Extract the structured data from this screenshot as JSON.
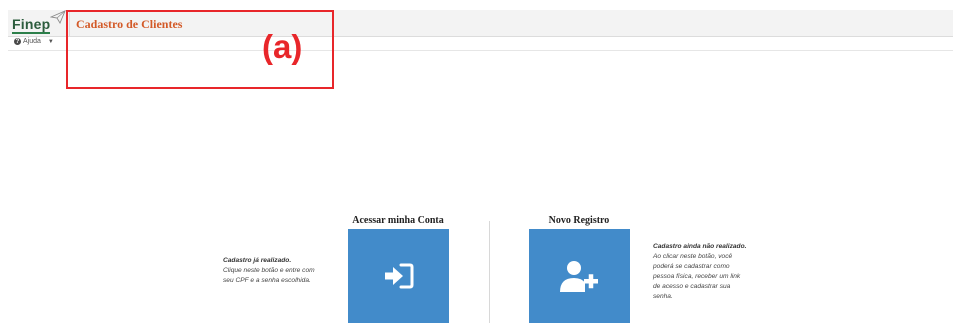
{
  "header": {
    "logo_text": "Finep",
    "page_title": "Cadastro de Clientes"
  },
  "help_menu": {
    "label": "Ajuda"
  },
  "annotation": {
    "label": "(a)",
    "color": "#e8262a"
  },
  "login": {
    "title": "Acessar minha Conta",
    "info_heading": "Cadastro já realizado.",
    "info_lines": [
      "Clique neste botão e entre com",
      "seu CPF e a senha escolhida."
    ],
    "icon": "sign-in-icon"
  },
  "register": {
    "title": "Novo Registro",
    "info_heading": "Cadastro ainda não realizado.",
    "info_lines": [
      "Ao clicar neste botão, você",
      "poderá se cadastrar como",
      "pessoa física, receber um link",
      "de acesso e cadastrar sua",
      "senha."
    ],
    "icon": "add-user-icon"
  },
  "colors": {
    "button": "#428bca",
    "title": "#d35a28",
    "logo": "#2c5c3d"
  }
}
